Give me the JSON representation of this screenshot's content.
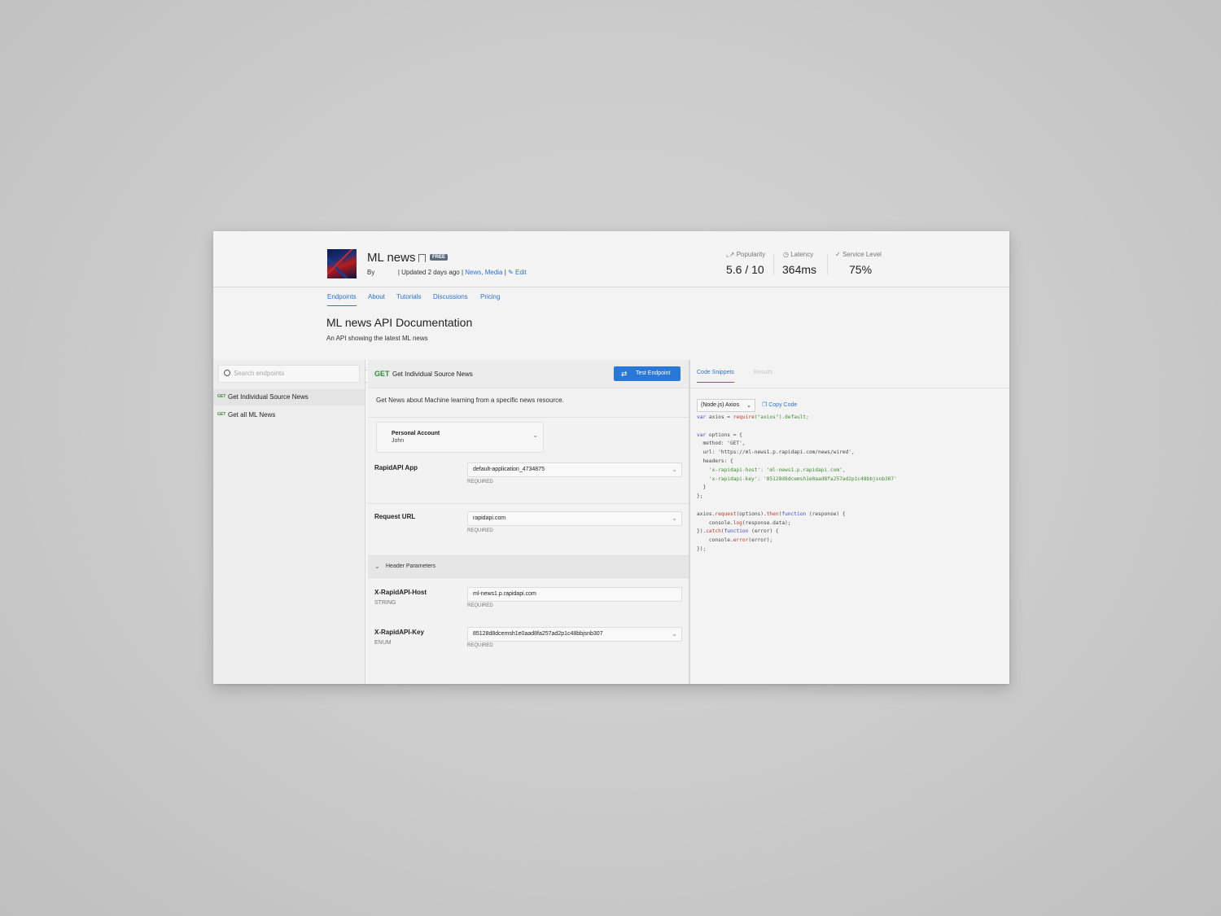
{
  "api": {
    "title": "ML news",
    "badge": "FREE",
    "by_label": "By",
    "updated": "| Updated 2 days ago |",
    "categories": "News, Media",
    "sep": "|",
    "edit": "Edit"
  },
  "stats": [
    {
      "label": "Popularity",
      "value": "5.6 / 10"
    },
    {
      "label": "Latency",
      "value": "364ms"
    },
    {
      "label": "Service Level",
      "value": "75%"
    }
  ],
  "tabs": [
    "Endpoints",
    "About",
    "Tutorials",
    "Discussions",
    "Pricing"
  ],
  "doc": {
    "title": "ML news API Documentation",
    "subtitle": "An API showing the latest ML news"
  },
  "sidebar": {
    "search_placeholder": "Search endpoints",
    "endpoints": [
      {
        "method": "GET",
        "name": "Get Individual Source News"
      },
      {
        "method": "GET",
        "name": "Get all ML News"
      }
    ]
  },
  "endpoint": {
    "method": "GET",
    "name": "Get Individual Source News",
    "test_button": "Test Endpoint",
    "description": "Get News about Machine learning from a specific news resource.",
    "account_title": "Personal Account",
    "account_user": "John",
    "rapidapi_app_label": "RapidAPI App",
    "rapidapi_app_value": "default-application_4734875",
    "request_url_label": "Request URL",
    "request_url_value": "rapidapi.com",
    "required": "REQUIRED",
    "header_params_label": "Header Parameters",
    "host_label": "X-RapidAPI-Host",
    "host_type": "STRING",
    "host_value": "ml-news1.p.rapidapi.com",
    "key_label": "X-RapidAPI-Key",
    "key_type": "ENUM",
    "key_value": "85128d8dcemsh1e0aad8fa257ad2p1c48bbjsnb307"
  },
  "code_panel": {
    "tab_snippets": "Code Snippets",
    "tab_results": "Results",
    "language": "(Node.js) Axios",
    "copy_code": "Copy Code"
  },
  "code": {
    "l1a": "var",
    "l1b": " axios = ",
    "l1c": "require",
    "l1d": "(\"axios\").default;",
    "l3a": "var",
    "l3b": " options = {",
    "l4": "  method: 'GET',",
    "l5": "  url: 'https://ml-news1.p.rapidapi.com/news/wired',",
    "l6": "  headers: {",
    "l7": "    'x-rapidapi-host': 'ml-news1.p.rapidapi.com',",
    "l8": "    'x-rapidapi-key': '85128d8dcemsh1e0aad8fa257ad2p1c48bbjsnb307'",
    "l9": "  }",
    "l10": "};",
    "l12a": "axios.",
    "l12b": "request",
    "l12c": "(options).",
    "l12d": "then",
    "l12e": "(",
    "l12f": "function",
    "l12g": " (response) {",
    "l13a": "    console.",
    "l13b": "log",
    "l13c": "(response.data);",
    "l14a": "}).",
    "l14b": "catch",
    "l14c": "(",
    "l14d": "function",
    "l14e": " (error) {",
    "l15a": "    console.",
    "l15b": "error",
    "l15c": "(error);",
    "l16": "});"
  },
  "colors": {
    "accent": "#2a73d8",
    "get_method": "#2e8b3a",
    "button": "#2a78d6"
  }
}
